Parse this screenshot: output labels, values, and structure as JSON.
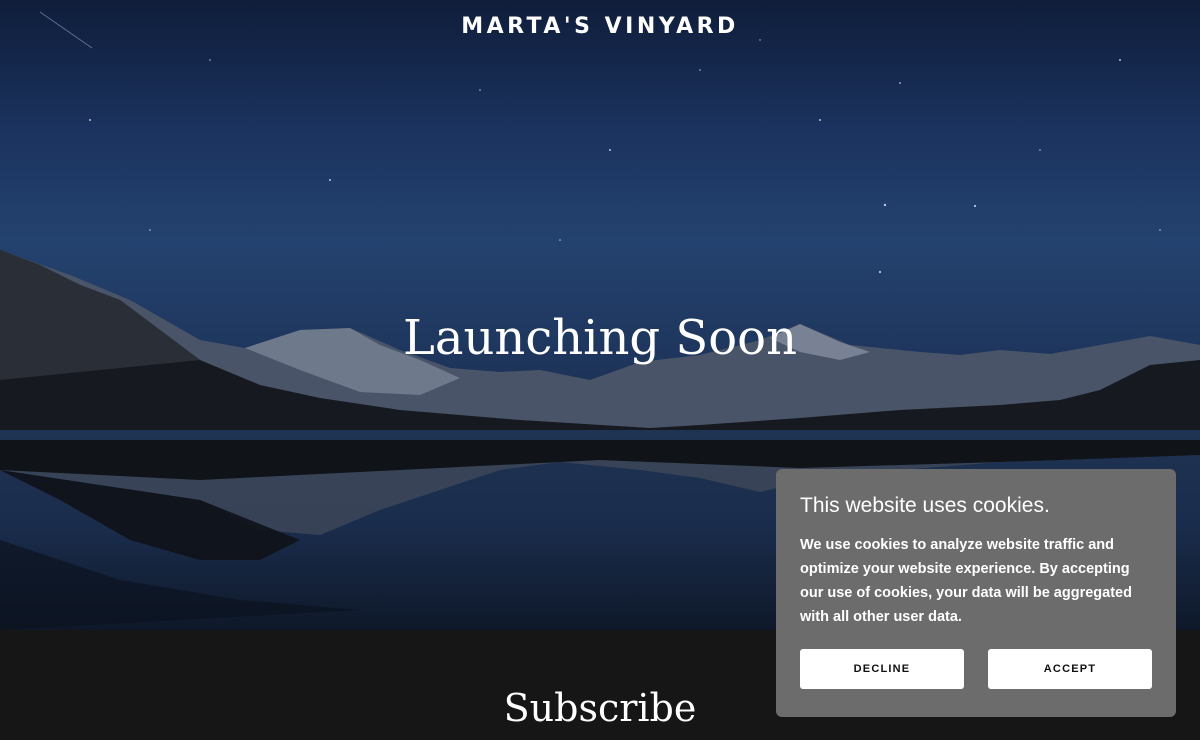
{
  "site": {
    "brand": "MARTA'S VINYARD",
    "headline": "Launching Soon",
    "subscribe_heading": "Subscribe"
  },
  "cookie_banner": {
    "title": "This website uses cookies.",
    "body": "We use cookies to analyze website traffic and optimize your website experience. By accepting our use of cookies, your data will be aggregated with all other user data.",
    "decline_label": "DECLINE",
    "accept_label": "ACCEPT"
  },
  "colors": {
    "cookie_background": "#6c6c6c",
    "lower_section_background": "#161616",
    "button_background": "#ffffff"
  }
}
